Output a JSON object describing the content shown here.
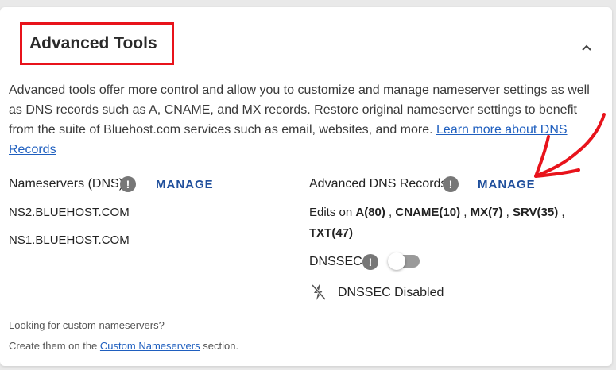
{
  "section": {
    "title": "Advanced Tools",
    "description": "Advanced tools offer more control and allow you to customize and manage nameserver settings as well as DNS records such as A, CNAME, and MX records. Restore original nameserver settings to benefit from the suite of Bluehost.com services such as email, websites, and more.",
    "learn_more_link": "Learn more about DNS Records"
  },
  "nameservers": {
    "label": "Nameservers (DNS)",
    "manage_label": "MANAGE",
    "servers": [
      "NS2.BLUEHOST.COM",
      "NS1.BLUEHOST.COM"
    ]
  },
  "dns_records": {
    "label": "Advanced DNS Records",
    "manage_label": "MANAGE",
    "edits_prefix": "Edits on",
    "records": [
      "A(80)",
      "CNAME(10)",
      "MX(7)",
      "SRV(35)",
      "TXT(47)"
    ]
  },
  "dnssec": {
    "label": "DNSSEC",
    "enabled": false,
    "status_text": "DNSSEC Disabled"
  },
  "footer": {
    "line1": "Looking for custom nameservers?",
    "line2_prefix": "Create them on the",
    "line2_link": "Custom Nameservers",
    "line2_suffix": "section."
  },
  "info_glyph": "!",
  "icons": [
    "chevron-up-icon",
    "info-icon",
    "lightning-off-icon",
    "annotation-arrow"
  ],
  "colors": {
    "accent": "#1f4f9c",
    "link": "#1f5fbf",
    "highlight_box": "#e8131b",
    "annotation_arrow": "#e8131b",
    "toggle_off": "#9a9a9a"
  }
}
